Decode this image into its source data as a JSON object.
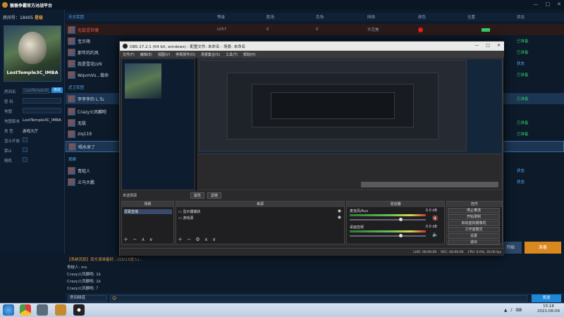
{
  "window": {
    "title": "猴猴争霸官方对战平台",
    "controls": [
      "—",
      "□",
      "✕"
    ]
  },
  "room": {
    "label": "房间号：",
    "number": "18405",
    "tag": "星级",
    "avatar_caption": "LostTemple3C_IMBA",
    "fields": [
      {
        "label": "房间名",
        "value": "LostTemple3C_IMBA"
      },
      {
        "label": "密 码",
        "value": ""
      },
      {
        "label": "地图",
        "value": ""
      },
      {
        "label": "地图版本",
        "value": "LostTemple3C_IMBA"
      },
      {
        "label": "类 型",
        "value": "游戏大厅"
      },
      {
        "label": "显示开放",
        "value": ""
      },
      {
        "label": "禁止",
        "value": ""
      },
      {
        "label": "随机",
        "value": ""
      }
    ],
    "modify_button": "修改"
  },
  "list": {
    "headers": [
      "天灾军团",
      "等级",
      "胜场",
      "负场",
      "网络",
      "颜色",
      "位置",
      "状态"
    ],
    "section_1": "天灾军团",
    "section_2": "近卫军团",
    "section_3": "观察",
    "rows_1": [
      {
        "name": "无敌混世魔",
        "level": "LV57",
        "win": "0",
        "loss": "0",
        "net": "不完美",
        "status": ""
      },
      {
        "name": "宝贝萌",
        "level": "",
        "win": "",
        "loss": "",
        "net": "",
        "status": "已准备"
      },
      {
        "name": "那年的约风",
        "level": "",
        "win": "",
        "loss": "",
        "net": "",
        "status": "已准备"
      },
      {
        "name": "我是雪花LV9",
        "level": "",
        "win": "",
        "loss": "",
        "net": "",
        "status": "状态"
      },
      {
        "name": "WqvmVs...做命",
        "level": "",
        "win": "",
        "loss": "",
        "net": "",
        "status": "已准备"
      }
    ],
    "rows_2": [
      {
        "name": "李李李的 L.Tu",
        "status": "已准备"
      },
      {
        "name": "Crazy火凤麟咆",
        "status": ""
      },
      {
        "name": "无敌",
        "status": "已准备"
      },
      {
        "name": "ziq119",
        "status": "已准备"
      },
      {
        "name": "喝水来了",
        "status": ""
      }
    ],
    "rows_3": [
      {
        "name": "青蛙人",
        "status": "状态"
      },
      {
        "name": "义马大鹏",
        "status": "状态"
      }
    ]
  },
  "buttons": {
    "start": "开始",
    "ready": "准备",
    "send": "发送"
  },
  "chat": {
    "system": "【系统消息】双方请准备好...(13/13进入)...",
    "lines": [
      "青蛙人: ms",
      "Crazy火凤麟咆: 1k",
      "Crazy火凤麟咆: 1k",
      "Crazy火凤麟咆: ？"
    ],
    "channel": "房间频道"
  },
  "obs": {
    "title": "OBS 27.2.1 (64 bit, windows) - 配置文件: 未命名 - 场景: 未命名",
    "menu": [
      "文件(F)",
      "编辑(E)",
      "视图(V)",
      "停靠部件(D)",
      "场景集合(S)",
      "工具(T)",
      "帮助(H)"
    ],
    "scene_bar": "未选择源",
    "properties": "属性",
    "filters": "滤镜",
    "docks": {
      "scenes": "场景",
      "sources": "来源",
      "mixer": "混音器",
      "controls": "控件"
    },
    "scene_items": [
      "屏幕直播"
    ],
    "source_items": [
      "显示器捕获",
      "游戏源"
    ],
    "mixer_items": [
      {
        "name": "麦克风/Aux",
        "db": "0.0 dB"
      },
      {
        "name": "桌面音频",
        "db": "0.0 dB"
      }
    ],
    "controls": [
      "停止推流",
      "开始录制",
      "启动虚拟摄像机",
      "工作室模式",
      "设置",
      "退出"
    ],
    "status": [
      "LIVE: 00:00:00",
      "REC: 00:00:00",
      "CPU: 6.0%, 30.00 fps"
    ]
  },
  "taskbar": {
    "time": "15:18",
    "date": "2021-06-09"
  },
  "colors": {
    "accent_blue": "#1e88d8",
    "ready_orange": "#d9881f",
    "status_green": "#34c96a",
    "room_tag": "#e8a33c"
  }
}
